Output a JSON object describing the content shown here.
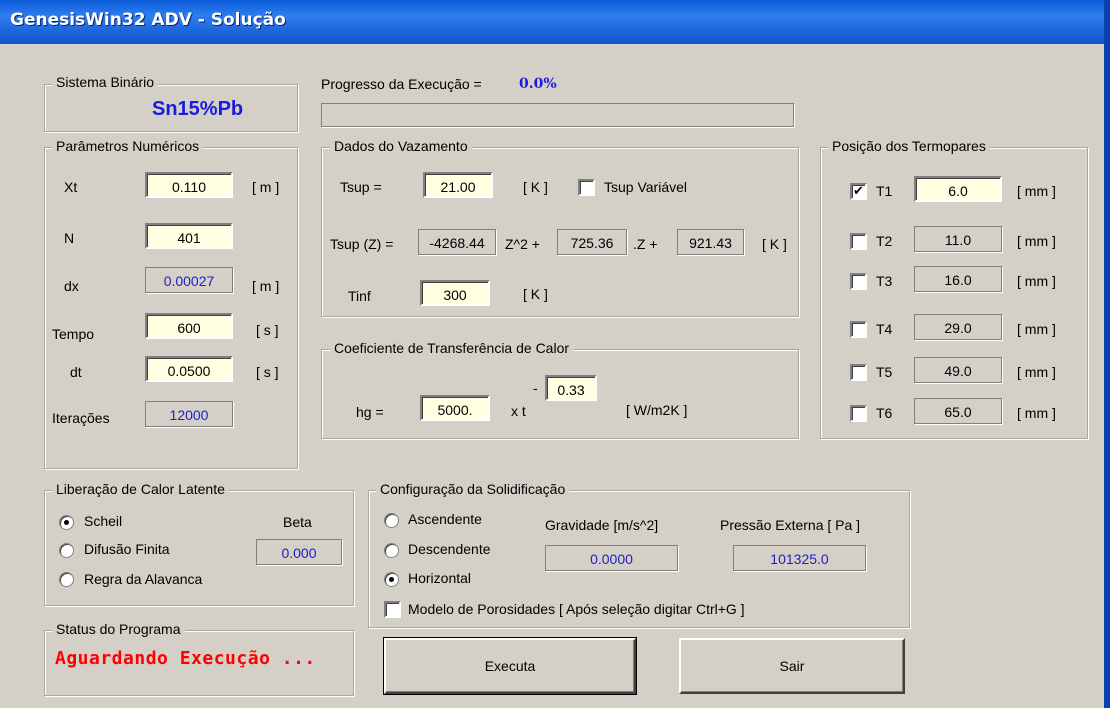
{
  "window": {
    "title": "GenesisWin32 ADV - Solução"
  },
  "sistema": {
    "label": "Sistema Binário",
    "value": "Sn15%Pb"
  },
  "progress": {
    "label": "Progresso da Execução =",
    "value": "0.0%",
    "fraction": 0
  },
  "parametros": {
    "label": "Parâmetros Numéricos",
    "xt": {
      "label": "Xt",
      "value": "0.110",
      "unit": "[ m ]"
    },
    "n": {
      "label": "N",
      "value": "401"
    },
    "dx": {
      "label": "dx",
      "value": "0.00027",
      "unit": "[ m ]"
    },
    "tempo": {
      "label": "Tempo",
      "value": "600",
      "unit": "[ s ]"
    },
    "dt": {
      "label": "dt",
      "value": "0.0500",
      "unit": "[ s ]"
    },
    "iteracoes": {
      "label": "Iterações",
      "value": "12000"
    }
  },
  "vazamento": {
    "label": "Dados do Vazamento",
    "tsup": {
      "label": "Tsup =",
      "value": "21.00",
      "unit": "[ K ]"
    },
    "tsup_variavel": {
      "label": "Tsup Variável",
      "checked": false
    },
    "tsupz": {
      "label": "Tsup (Z) =",
      "a": "-4268.44",
      "a_suffix": "Z^2 +",
      "b": "725.36",
      "b_suffix": ".Z +",
      "c": "921.43",
      "unit": "[ K ]"
    },
    "tinf": {
      "label": "Tinf",
      "value": "300",
      "unit": "[ K ]"
    }
  },
  "coeficiente": {
    "label": "Coeficiente de Transferência de Calor",
    "hg_label": "hg =",
    "hg": "5000.",
    "times_t": "x t",
    "exp_dash": "-",
    "exponent": "0.33",
    "unit": "[ W/m2K ]"
  },
  "termopares": {
    "label": "Posição dos Termopares",
    "unit": "[ mm ]",
    "items": [
      {
        "name": "T1",
        "value": "6.0",
        "checked": true
      },
      {
        "name": "T2",
        "value": "11.0",
        "checked": false
      },
      {
        "name": "T3",
        "value": "16.0",
        "checked": false
      },
      {
        "name": "T4",
        "value": "29.0",
        "checked": false
      },
      {
        "name": "T5",
        "value": "49.0",
        "checked": false
      },
      {
        "name": "T6",
        "value": "65.0",
        "checked": false
      }
    ]
  },
  "latente": {
    "label": "Liberação de Calor Latente",
    "options": [
      "Scheil",
      "Difusão Finita",
      "Regra da Alavanca"
    ],
    "selected": "Scheil",
    "beta_label": "Beta",
    "beta": "0.000"
  },
  "solidificacao": {
    "label": "Configuração da Solidificação",
    "options": [
      "Ascendente",
      "Descendente",
      "Horizontal"
    ],
    "selected": "Horizontal",
    "gravidade_label": "Gravidade [m/s^2]",
    "gravidade": "0.0000",
    "pressao_label": "Pressão Externa [ Pa ]",
    "pressao": "101325.0",
    "porosidade": {
      "label": "Modelo de Porosidades [ Após seleção digitar Ctrl+G ]",
      "checked": false
    }
  },
  "status": {
    "label": "Status do Programa",
    "value": "Aguardando Execução ...",
    "color": "#ff0000"
  },
  "buttons": {
    "executa": "Executa",
    "sair": "Sair"
  }
}
